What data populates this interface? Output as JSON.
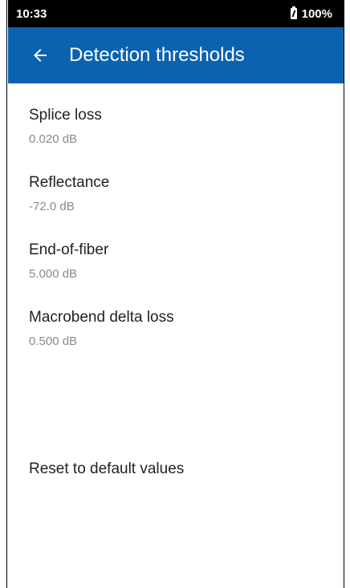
{
  "status_bar": {
    "time": "10:33",
    "battery": "100%"
  },
  "app_bar": {
    "title": "Detection thresholds",
    "back_icon": "arrow-back-icon",
    "color": "#0b63b0"
  },
  "settings": [
    {
      "label": "Splice loss",
      "value": "0.020 dB"
    },
    {
      "label": "Reflectance",
      "value": "-72.0 dB"
    },
    {
      "label": "End-of-fiber",
      "value": "5.000 dB"
    },
    {
      "label": "Macrobend delta loss",
      "value": "0.500 dB"
    }
  ],
  "reset_label": "Reset to default values"
}
